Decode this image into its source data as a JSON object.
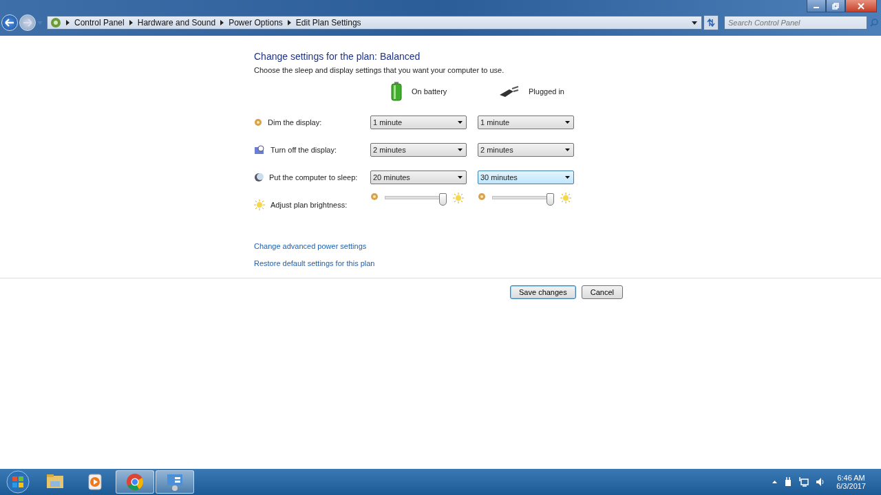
{
  "window": {
    "breadcrumbs": [
      "Control Panel",
      "Hardware and Sound",
      "Power Options",
      "Edit Plan Settings"
    ],
    "search": {
      "placeholder": "Search Control Panel"
    }
  },
  "content": {
    "heading": "Change settings for the plan: Balanced",
    "subheading": "Choose the sleep and display settings that you want your computer to use.",
    "columns": [
      {
        "kind": "battery",
        "label": "On battery"
      },
      {
        "kind": "plug",
        "label": "Plugged in"
      }
    ],
    "settings": [
      {
        "kind": "dropdown",
        "label": "Dim the display:",
        "values": [
          {
            "value": "1 minute",
            "focused": false
          },
          {
            "value": "1 minute",
            "focused": false
          }
        ]
      },
      {
        "kind": "dropdown",
        "label": "Turn off the display:",
        "values": [
          {
            "value": "2 minutes",
            "focused": false
          },
          {
            "value": "2 minutes",
            "focused": false
          }
        ]
      },
      {
        "kind": "dropdown",
        "label": "Put the computer to sleep:",
        "values": [
          {
            "value": "20 minutes",
            "focused": false
          },
          {
            "value": "30 minutes",
            "focused": true
          }
        ]
      },
      {
        "kind": "slider",
        "label": "Adjust plan brightness:",
        "values": [
          {
            "level": 0.96
          },
          {
            "level": 0.96
          }
        ]
      }
    ],
    "links": [
      "Change advanced power settings",
      "Restore default settings for this plan"
    ],
    "buttons": [
      {
        "label": "Save changes",
        "default": true
      },
      {
        "label": "Cancel",
        "default": false
      }
    ]
  },
  "taskbar": {
    "items": [
      {
        "kind": "folder",
        "active": false
      },
      {
        "kind": "media",
        "active": false
      },
      {
        "kind": "chrome",
        "active": true
      },
      {
        "kind": "control",
        "active": true
      }
    ],
    "time": "6:46 AM",
    "date": "6/3/2017"
  }
}
